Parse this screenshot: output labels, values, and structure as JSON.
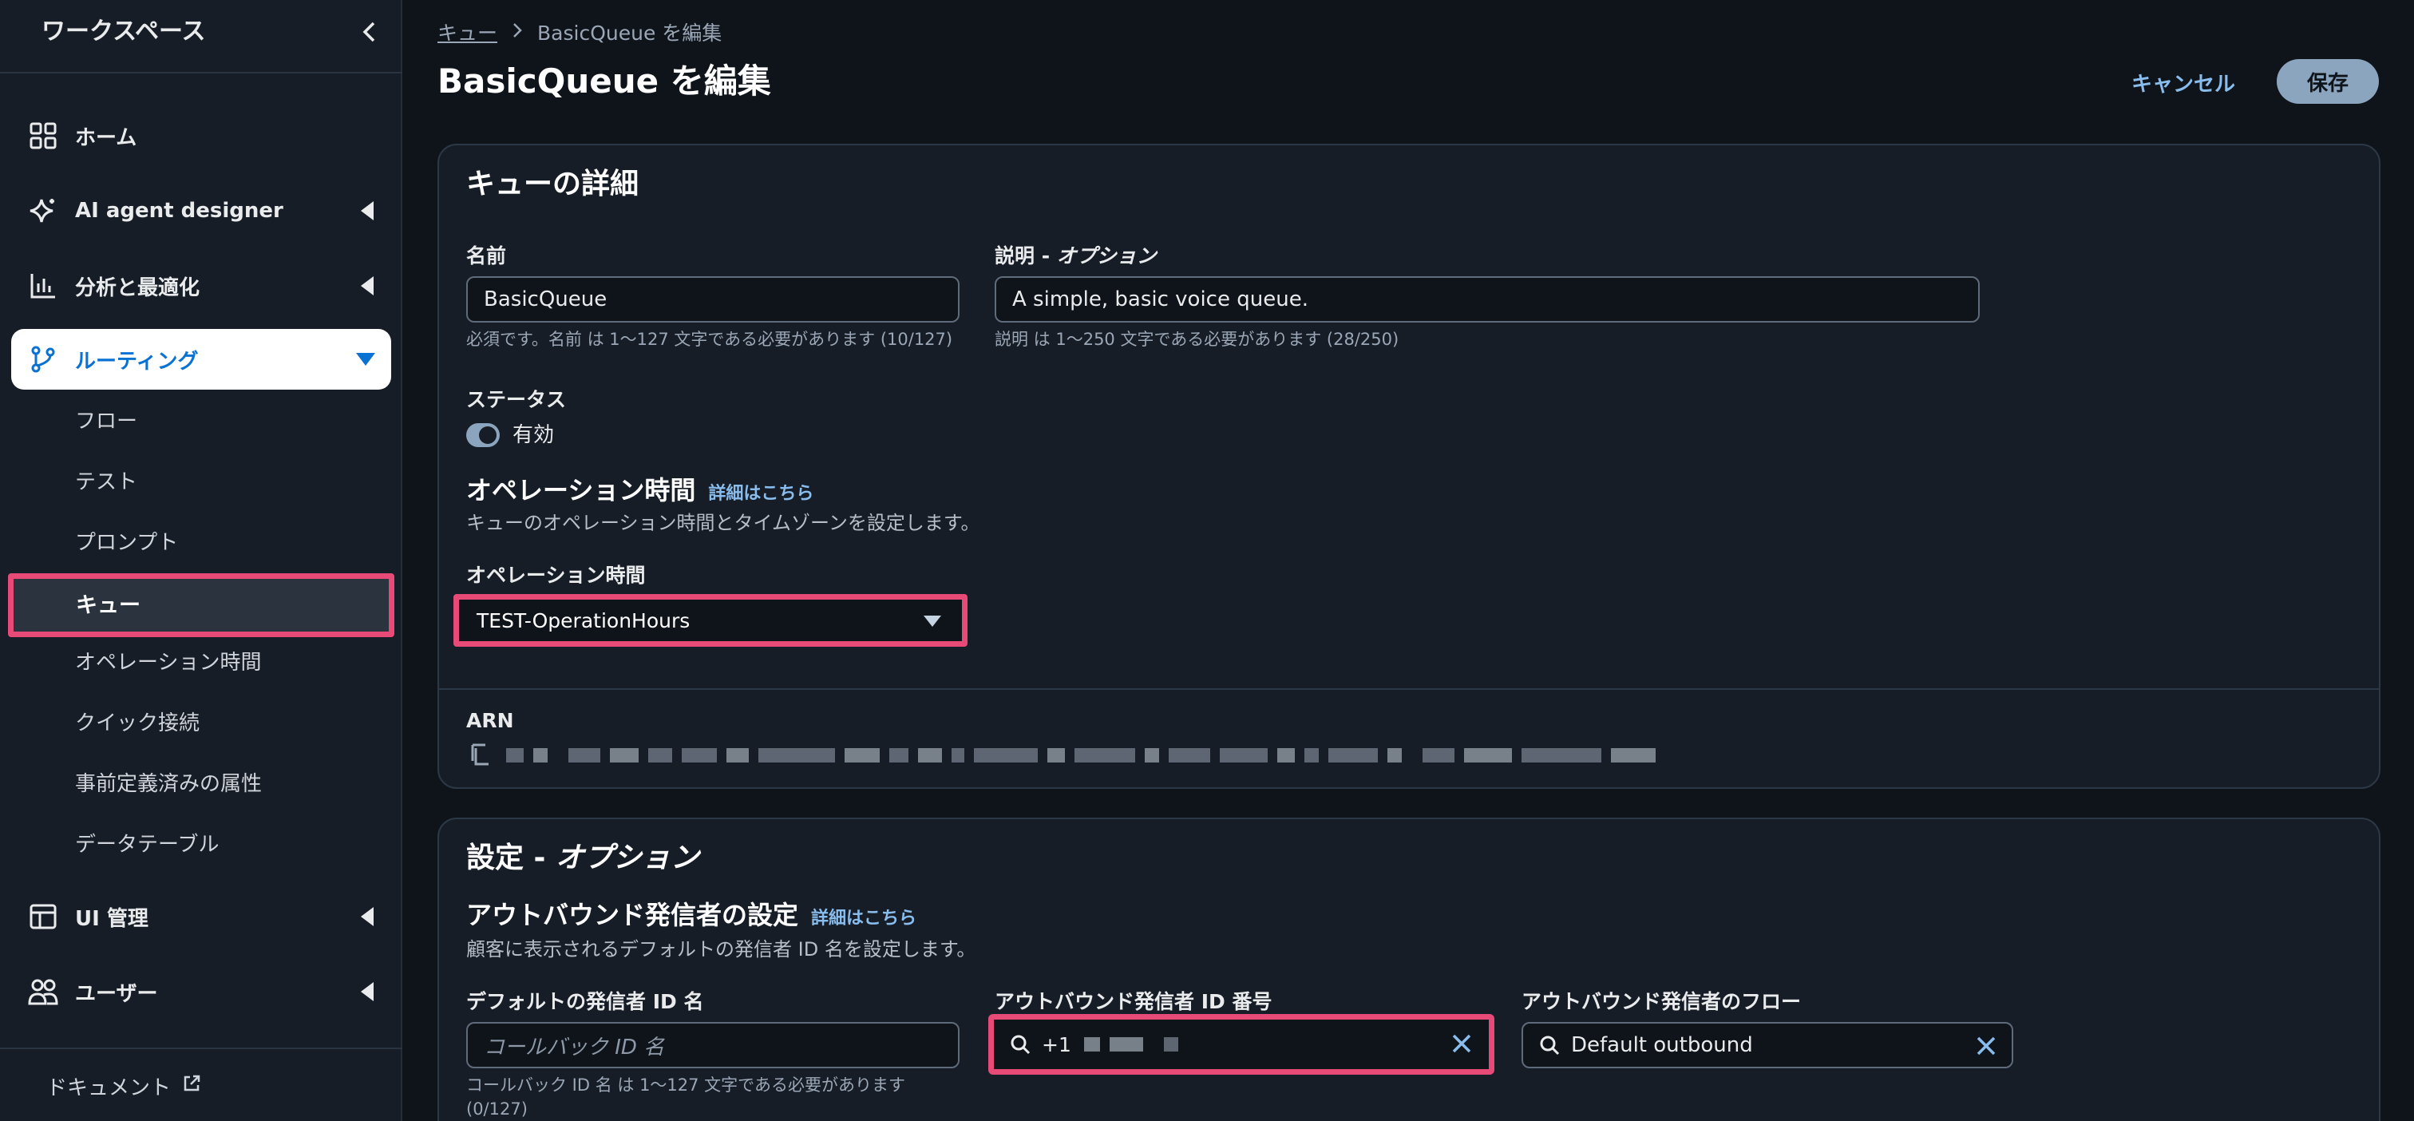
{
  "sidebar": {
    "title": "ワークスペース",
    "items": [
      {
        "label": "ホーム",
        "icon": "grid-icon"
      },
      {
        "label": "AI agent designer",
        "icon": "sparkle-icon"
      },
      {
        "label": "分析と最適化",
        "icon": "bar-chart-icon"
      },
      {
        "label": "ルーティング",
        "icon": "branch-icon"
      },
      {
        "label": "UI 管理",
        "icon": "layout-icon"
      },
      {
        "label": "ユーザー",
        "icon": "users-icon"
      }
    ],
    "routing_sub": [
      "フロー",
      "テスト",
      "プロンプト",
      "キュー",
      "オペレーション時間",
      "クイック接続",
      "事前定義済みの属性",
      "データテーブル"
    ],
    "footer": "ドキュメント"
  },
  "breadcrumb": {
    "parent": "キュー",
    "current": "BasicQueue を編集"
  },
  "page_title": "BasicQueue を編集",
  "actions": {
    "cancel": "キャンセル",
    "save": "保存"
  },
  "queue_details": {
    "heading": "キューの詳細",
    "name_label": "名前",
    "name_value": "BasicQueue",
    "name_hint": "必須です。名前 は 1〜127 文字である必要があります (10/127)",
    "desc_label": "説明 - ",
    "desc_label_opt": "オプション",
    "desc_value": "A simple, basic voice queue.",
    "desc_hint": "説明 は 1〜250 文字である必要があります (28/250)",
    "status_label": "ステータス",
    "status_value": "有効",
    "hours_heading": "オペレーション時間",
    "hours_info_link": "詳細はこちら",
    "hours_desc": "キューのオペレーション時間とタイムゾーンを設定します。",
    "hours_field_label": "オペレーション時間",
    "hours_value": "TEST-OperationHours",
    "arn_label": "ARN"
  },
  "settings": {
    "heading": "設定 - ",
    "heading_opt": "オプション",
    "outbound_heading": "アウトバウンド発信者の設定",
    "outbound_info_link": "詳細はこちら",
    "outbound_desc": "顧客に表示されるデフォルトの発信者 ID 名を設定します。",
    "caller_name_label": "デフォルトの発信者 ID 名",
    "caller_name_placeholder": "コールバック ID 名",
    "caller_name_hint": "コールバック ID 名 は 1〜127 文字である必要があります (0/127)",
    "caller_number_label": "アウトバウンド発信者 ID 番号",
    "caller_number_value": "+1",
    "caller_flow_label": "アウトバウンド発信者のフロー",
    "caller_flow_value": "Default outbound"
  }
}
